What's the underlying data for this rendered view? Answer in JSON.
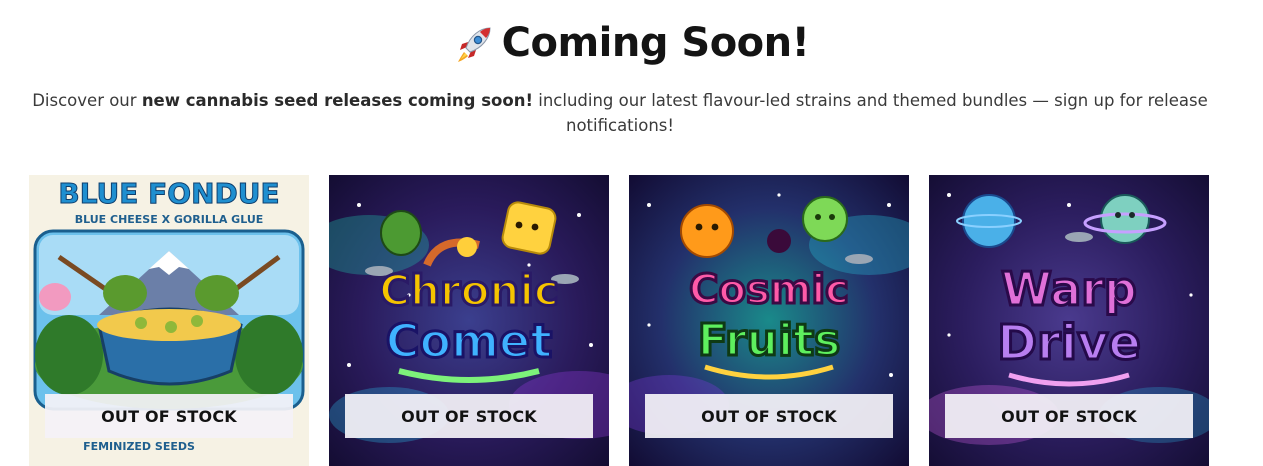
{
  "heading": {
    "icon": "rocket-icon",
    "title": "Coming Soon!"
  },
  "intro": {
    "prefix": "Discover our ",
    "bold": "new cannabis seed releases coming soon!",
    "suffix": " including our latest flavour-led strains and themed bundles — sign up for release notifications!"
  },
  "products": [
    {
      "art_title": "BLUE FONDUE",
      "art_subtitle": "BLUE CHEESE X GORILLA GLUE",
      "art_footer": "FEMINIZED SEEDS",
      "stock_label": "OUT OF STOCK",
      "accent": "#1f8fd0"
    },
    {
      "art_title_line1": "Chronic",
      "art_title_line2": "Comet",
      "stock_label": "OUT OF STOCK",
      "accent": "#f5c400"
    },
    {
      "art_title_line1": "Cosmic",
      "art_title_line2": "Fruits",
      "stock_label": "OUT OF STOCK",
      "accent": "#e0569a"
    },
    {
      "art_title_line1": "Warp",
      "art_title_line2": "Drive",
      "stock_label": "OUT OF STOCK",
      "accent": "#c86ad8"
    }
  ]
}
